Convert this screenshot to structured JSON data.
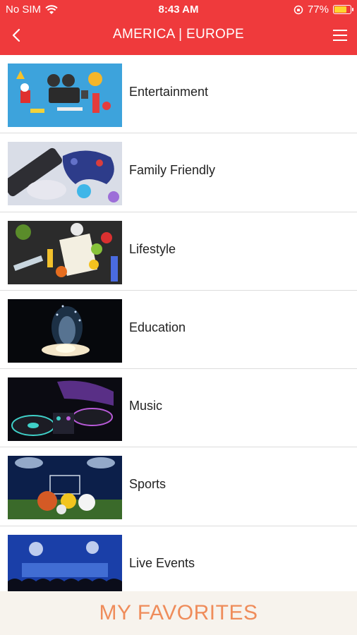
{
  "status_bar": {
    "carrier": "No SIM",
    "time": "8:43 AM",
    "battery_percent": "77%",
    "battery_level": 0.77
  },
  "navbar": {
    "title": "AMERICA | EUROPE",
    "back_icon": "chevron-left-icon",
    "menu_icon": "hamburger-menu-icon"
  },
  "categories": [
    {
      "label": "Entertainment"
    },
    {
      "label": "Family Friendly"
    },
    {
      "label": "Lifestyle"
    },
    {
      "label": "Education"
    },
    {
      "label": "Music"
    },
    {
      "label": "Sports"
    },
    {
      "label": "Live Events"
    }
  ],
  "favorites": {
    "label": "MY FAVORITES"
  },
  "colors": {
    "header": "#ef3a3c",
    "favorites_bg": "#f7f3ed",
    "favorites_text": "#ef8c5a"
  }
}
